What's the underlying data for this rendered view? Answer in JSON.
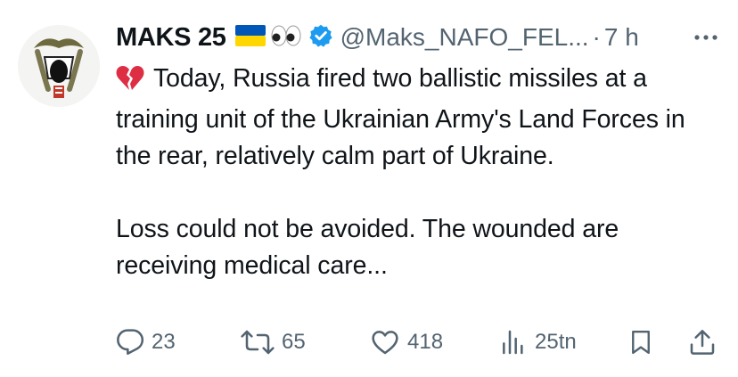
{
  "tweet": {
    "author": {
      "name": "MAKS 25",
      "handle": "@Maks_NAFO_FEL...",
      "verified": true
    },
    "separator": "·",
    "time": "7 h",
    "icons": {
      "flag": "ukraine-flag-icon",
      "eyes": "eyes-emoji-icon",
      "verified": "verified-badge-icon",
      "broken_heart": "broken-heart-icon",
      "more": "more-options-icon"
    },
    "body": {
      "paragraph1": "Today, Russia fired two ballistic missiles at a training unit of the Ukrainian Army's Land Forces in the rear, relatively calm part of Ukraine.",
      "paragraph2": "Loss could not be avoided. The wounded are receiving medical care..."
    },
    "actions": {
      "replies": "23",
      "reposts": "65",
      "likes": "418",
      "views": "25tn"
    },
    "colors": {
      "verified": "#1d9bf0",
      "secondary_text": "#536471",
      "flag_blue": "#0057b7",
      "flag_yellow": "#ffd700"
    }
  }
}
